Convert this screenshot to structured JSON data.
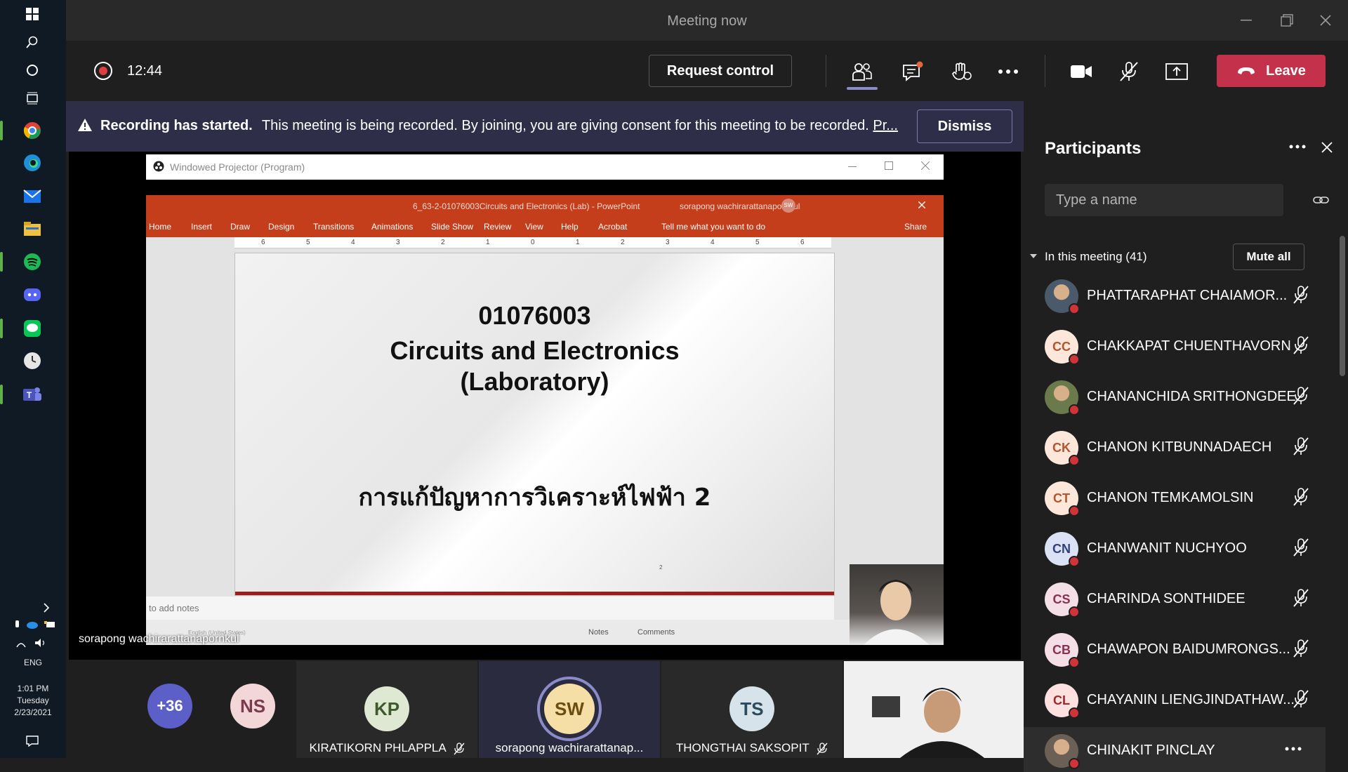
{
  "window": {
    "title": "Meeting now"
  },
  "controls": {
    "timer": "12:44",
    "request_control": "Request control",
    "leave": "Leave"
  },
  "banner": {
    "heading": "Recording has started.",
    "message": "This meeting is being recorded. By joining, you are giving consent for this meeting to be recorded.",
    "link": "Pr...",
    "dismiss": "Dismiss"
  },
  "projector": {
    "window_title": "Windowed Projector (Program)",
    "pp_file": "6_63-2-01076003Circuits and Electronics (Lab)  -  PowerPoint",
    "pp_user": "sorapong wachirarattanapornkul",
    "pp_user_initials": "SW",
    "ribbon": [
      "Home",
      "Insert",
      "Draw",
      "Design",
      "Transitions",
      "Animations",
      "Slide Show",
      "Review",
      "View",
      "Help",
      "Acrobat"
    ],
    "tell_me": "Tell me what you want to do",
    "share": "Share",
    "ruler_marks": [
      "6",
      "5",
      "4",
      "3",
      "2",
      "1",
      "0",
      "1",
      "2",
      "3",
      "4",
      "5",
      "6"
    ],
    "slide": {
      "code": "01076003",
      "title1": "Circuits and Electronics",
      "title2": "(Laboratory)",
      "thai": "การแก้ปัญหาการวิเคราะห์ไฟฟ้า 2",
      "number": "2"
    },
    "notes_placeholder": "to add notes",
    "status_language": "English (United States)",
    "status_notes": "Notes",
    "status_comments": "Comments"
  },
  "stage": {
    "presenter_name": "sorapong wachirarattanapornkul"
  },
  "gallery": {
    "overflow": "+36",
    "tiles": [
      {
        "initials": "NS",
        "name": ""
      },
      {
        "initials": "KP",
        "name": "KIRATIKORN PHLAPPLA"
      },
      {
        "initials": "SW",
        "name": "sorapong wachirarattanap..."
      },
      {
        "initials": "TS",
        "name": "THONGTHAI SAKSOPIT"
      }
    ]
  },
  "participants": {
    "title": "Participants",
    "search_placeholder": "Type a name",
    "section": "In this meeting (41)",
    "mute_all": "Mute all",
    "list": [
      {
        "initials": "",
        "name": "PHATTARAPHAT CHAIAMOR...",
        "photo": true
      },
      {
        "initials": "CC",
        "name": "CHAKKAPAT CHUENTHAVORN",
        "photo": false
      },
      {
        "initials": "",
        "name": "CHANANCHIDA SRITHONGDEE",
        "photo": true
      },
      {
        "initials": "CK",
        "name": "CHANON KITBUNNADAECH",
        "photo": false
      },
      {
        "initials": "CT",
        "name": "CHANON TEMKAMOLSIN",
        "photo": false
      },
      {
        "initials": "CN",
        "name": "CHANWANIT NUCHYOO",
        "photo": false
      },
      {
        "initials": "CS",
        "name": "CHARINDA SONTHIDEE",
        "photo": false
      },
      {
        "initials": "CB",
        "name": "CHAWAPON BAIDUMRONGS...",
        "photo": false
      },
      {
        "initials": "CL",
        "name": "CHAYANIN LIENGJINDATHAW...",
        "photo": false
      },
      {
        "initials": "",
        "name": "CHINAKIT PINCLAY",
        "photo": true
      }
    ]
  },
  "taskbar": {
    "language": "ENG",
    "time": "1:01 PM",
    "day": "Tuesday",
    "date": "2/23/2021"
  },
  "colors": {
    "leave": "#c4314b",
    "banner": "#2e2e48",
    "accent": "#8b8cc7",
    "powerpoint": "#c43e1c"
  }
}
